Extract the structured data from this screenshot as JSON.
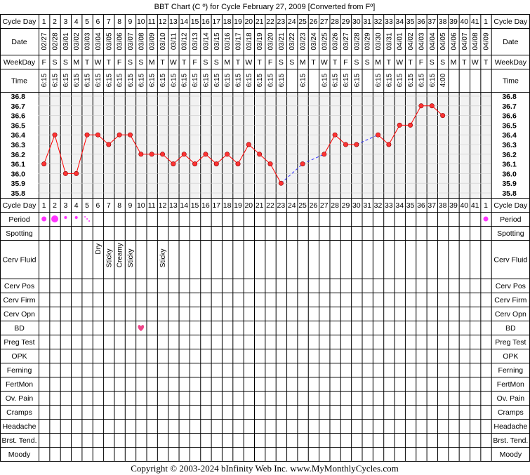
{
  "title": "BBT Chart (C º) for Cycle February 27, 2009  [Converted from Fº]",
  "copyright": "Copyright © 2003-2024 bInfinity Web Inc.     www.MyMonthlyCycles.com",
  "row_labels": {
    "cycle_day": "Cycle Day",
    "date": "Date",
    "weekday": "WeekDay",
    "time": "Time",
    "period": "Period",
    "spotting": "Spotting",
    "cerv_fluid": "Cerv Fluid",
    "cerv_pos": "Cerv Pos",
    "cerv_firm": "Cerv Firm",
    "cerv_opn": "Cerv Opn",
    "bd": "BD",
    "preg_test": "Preg Test",
    "opk": "OPK",
    "ferning": "Ferning",
    "fertmon": "FertMon",
    "ov_pain": "Ov. Pain",
    "cramps": "Cramps",
    "headache": "Headache",
    "brst_tend": "Brst. Tend.",
    "moody": "Moody"
  },
  "cycle_days": [
    "1",
    "2",
    "3",
    "4",
    "5",
    "6",
    "7",
    "8",
    "9",
    "10",
    "11",
    "12",
    "13",
    "14",
    "15",
    "16",
    "17",
    "18",
    "19",
    "20",
    "21",
    "22",
    "23",
    "24",
    "25",
    "26",
    "27",
    "28",
    "29",
    "30",
    "31",
    "32",
    "33",
    "34",
    "35",
    "36",
    "37",
    "38",
    "39",
    "40",
    "41",
    "1"
  ],
  "dates": [
    "02/27",
    "02/28",
    "03/01",
    "03/02",
    "03/03",
    "03/04",
    "03/05",
    "03/06",
    "03/07",
    "03/08",
    "03/09",
    "03/10",
    "03/11",
    "03/12",
    "03/13",
    "03/14",
    "03/15",
    "03/16",
    "03/17",
    "03/18",
    "03/19",
    "03/20",
    "03/21",
    "03/22",
    "03/23",
    "03/24",
    "03/25",
    "03/26",
    "03/27",
    "03/28",
    "03/29",
    "03/30",
    "03/31",
    "04/01",
    "04/02",
    "04/03",
    "04/04",
    "04/05",
    "04/06",
    "04/07",
    "04/08",
    "04/09"
  ],
  "weekdays": [
    "F",
    "S",
    "S",
    "M",
    "T",
    "W",
    "T",
    "F",
    "S",
    "S",
    "M",
    "T",
    "W",
    "T",
    "F",
    "S",
    "S",
    "M",
    "T",
    "W",
    "T",
    "F",
    "S",
    "S",
    "M",
    "T",
    "W",
    "T",
    "F",
    "S",
    "S",
    "M",
    "T",
    "W",
    "T",
    "F",
    "S",
    "S",
    "M",
    "T",
    "W",
    "T"
  ],
  "times": [
    "6:15",
    "6:15",
    "6:15",
    "6:15",
    "6:15",
    "6:15",
    "6:15",
    "6:15",
    "6:15",
    "6:15",
    "6:15",
    "6:15",
    "6:15",
    "6:15",
    "6:15",
    "6:15",
    "6:15",
    "6:15",
    "6:15",
    "6:15",
    "6:15",
    "6:15",
    "6:15",
    "",
    "6:15",
    "",
    "6:15",
    "6:15",
    "6:15",
    "6:15",
    "",
    "6:15",
    "6:15",
    "6:15",
    "6:15",
    "6:15",
    "6:15",
    "4:00",
    "",
    "",
    "",
    ""
  ],
  "cerv_fluid": {
    "6": "Dry",
    "7": "Sticky",
    "8": "Creamy",
    "9": "Sticky",
    "12": "Sticky"
  },
  "period": {
    "1": "medium",
    "2": "heavy",
    "3": "light",
    "4": "light",
    "5": "spotting",
    "42": "medium"
  },
  "bd_days": [
    10
  ],
  "colors": {
    "grid_bg": "#ffffff",
    "chart_bg": "#f2f2f2",
    "line": "#ff0000",
    "dot_fill": "#ff3333",
    "dashed": "#3333ff",
    "period": "#ff33ff",
    "heart": "#ee4488",
    "border": "#000000"
  },
  "chart_data": {
    "type": "line",
    "title": "BBT Chart (C º) for Cycle February 27, 2009  [Converted from Fº]",
    "x": [
      "1",
      "2",
      "3",
      "4",
      "5",
      "6",
      "7",
      "8",
      "9",
      "10",
      "11",
      "12",
      "13",
      "14",
      "15",
      "16",
      "17",
      "18",
      "19",
      "20",
      "21",
      "22",
      "23",
      "24",
      "25",
      "26",
      "27",
      "28",
      "29",
      "30",
      "31",
      "32",
      "33",
      "34",
      "35",
      "36",
      "37",
      "38",
      "39",
      "40",
      "41",
      "1"
    ],
    "ylim": [
      35.8,
      36.8
    ],
    "yticks": [
      "36.8",
      "36.7",
      "36.6",
      "36.5",
      "36.4",
      "36.3",
      "36.2",
      "36.1",
      "36.0",
      "35.9",
      "35.8"
    ],
    "series": [
      {
        "values": [
          36.1,
          36.4,
          36.0,
          36.0,
          36.4,
          36.4,
          36.3,
          36.4,
          36.4,
          36.2,
          36.2,
          36.2,
          36.1,
          36.2,
          36.1,
          36.2,
          36.1,
          36.2,
          36.1,
          36.3,
          36.2,
          36.1,
          35.9,
          null,
          36.1,
          null,
          36.2,
          36.4,
          36.3,
          36.3,
          null,
          36.4,
          36.3,
          36.5,
          36.5,
          36.7,
          36.7,
          36.6,
          null,
          null,
          null,
          null
        ]
      }
    ]
  }
}
